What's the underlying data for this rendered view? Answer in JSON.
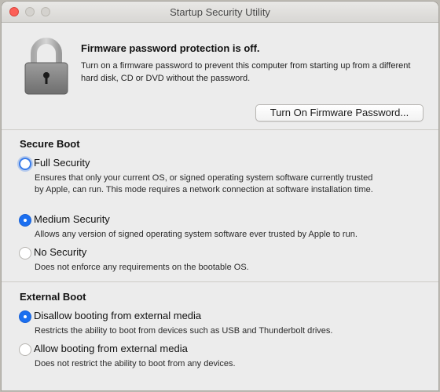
{
  "window": {
    "title": "Startup Security Utility"
  },
  "firmware": {
    "title": "Firmware password protection is off.",
    "description": "Turn on a firmware password to prevent this computer from starting up from a different hard disk, CD or DVD without the password.",
    "button_label": "Turn On Firmware Password..."
  },
  "secure_boot": {
    "title": "Secure Boot",
    "options": [
      {
        "label": "Full Security",
        "description": "Ensures that only your current OS, or signed operating system software currently trusted by Apple, can run. This mode requires a network connection at software installation time.",
        "state": "focused"
      },
      {
        "label": "Medium Security",
        "description": "Allows any version of signed operating system software ever trusted by Apple to run.",
        "state": "checked"
      },
      {
        "label": "No Security",
        "description": "Does not enforce any requirements on the bootable OS.",
        "state": "unchecked"
      }
    ]
  },
  "external_boot": {
    "title": "External Boot",
    "options": [
      {
        "label": "Disallow booting from external media",
        "description": "Restricts the ability to boot from devices such as USB and Thunderbolt drives.",
        "state": "checked"
      },
      {
        "label": "Allow booting from external media",
        "description": "Does not restrict the ability to boot from any devices.",
        "state": "unchecked"
      }
    ]
  },
  "colors": {
    "accent": "#1b6ff0",
    "window_bg": "#ececec"
  },
  "icons": {
    "lock": "lock-icon"
  }
}
